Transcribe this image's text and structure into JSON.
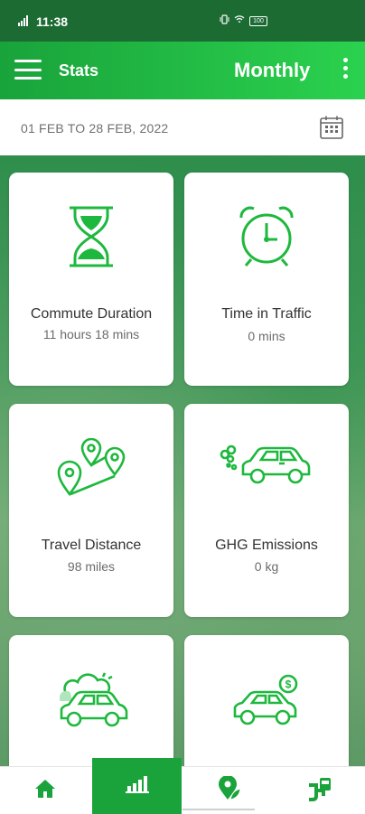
{
  "status": {
    "time": "11:38",
    "battery": "100"
  },
  "appbar": {
    "title": "Stats",
    "mode": "Monthly"
  },
  "date_range": "01 FEB TO 28 FEB, 2022",
  "cards": [
    {
      "label": "Commute Duration",
      "value": "11 hours 18 mins",
      "icon": "hourglass-icon"
    },
    {
      "label": "Time in Traffic",
      "value": "0 mins",
      "icon": "alarm-clock-icon"
    },
    {
      "label": "Travel Distance",
      "value": "98 miles",
      "icon": "route-pins-icon"
    },
    {
      "label": "GHG Emissions",
      "value": "0 kg",
      "icon": "car-exhaust-icon"
    },
    {
      "label": "",
      "value": "",
      "icon": "car-smoke-icon"
    },
    {
      "label": "",
      "value": "",
      "icon": "car-cost-icon"
    }
  ],
  "nav": [
    "home-icon",
    "stats-bars-icon",
    "map-leaf-icon",
    "transit-icon"
  ],
  "colors": {
    "status_bg": "#1b6b33",
    "accent": "#1aa33b",
    "icon_green": "#1db83d"
  }
}
